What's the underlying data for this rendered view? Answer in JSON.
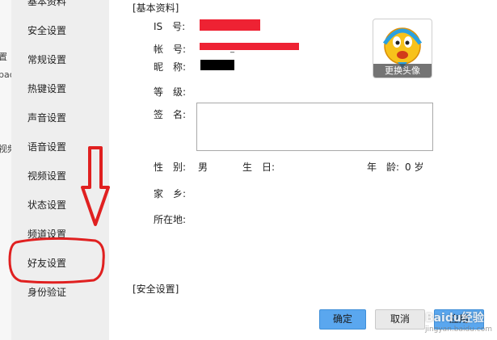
{
  "background_left": {
    "fragments": [
      "置",
      "pad",
      "视频"
    ]
  },
  "sidebar": {
    "items": [
      {
        "label": "基本资料"
      },
      {
        "label": "安全设置"
      },
      {
        "label": "常规设置"
      },
      {
        "label": "热键设置"
      },
      {
        "label": "声音设置"
      },
      {
        "label": "语音设置"
      },
      {
        "label": "视频设置"
      },
      {
        "label": "状态设置"
      },
      {
        "label": "频道设置"
      },
      {
        "label": "好友设置"
      },
      {
        "label": "身份验证"
      }
    ]
  },
  "profile": {
    "section_title": "[基本资料]",
    "is_label": "IS　号:",
    "account_label": "帐　号:",
    "account_suffix": "_",
    "nickname_label": "昵　称:",
    "level_label": "等　级:",
    "signature_label": "签　名:",
    "gender_label": "性　别:",
    "gender_value": "男",
    "birthday_label": "生　日:",
    "age_label": "年　龄:",
    "age_value": "0 岁",
    "hometown_label": "家　乡:",
    "location_label": "所在地:",
    "change_avatar_label": "更换头像"
  },
  "security": {
    "section_title": "[安全设置]"
  },
  "buttons": {
    "ok": "确定",
    "cancel": "取消",
    "apply": "应用"
  },
  "annotation": {
    "arrow_color": "#e02020",
    "highlight_color": "#e02020"
  },
  "watermark": {
    "text": "Baidu经验",
    "sub": "jingyan.baidu.com"
  }
}
